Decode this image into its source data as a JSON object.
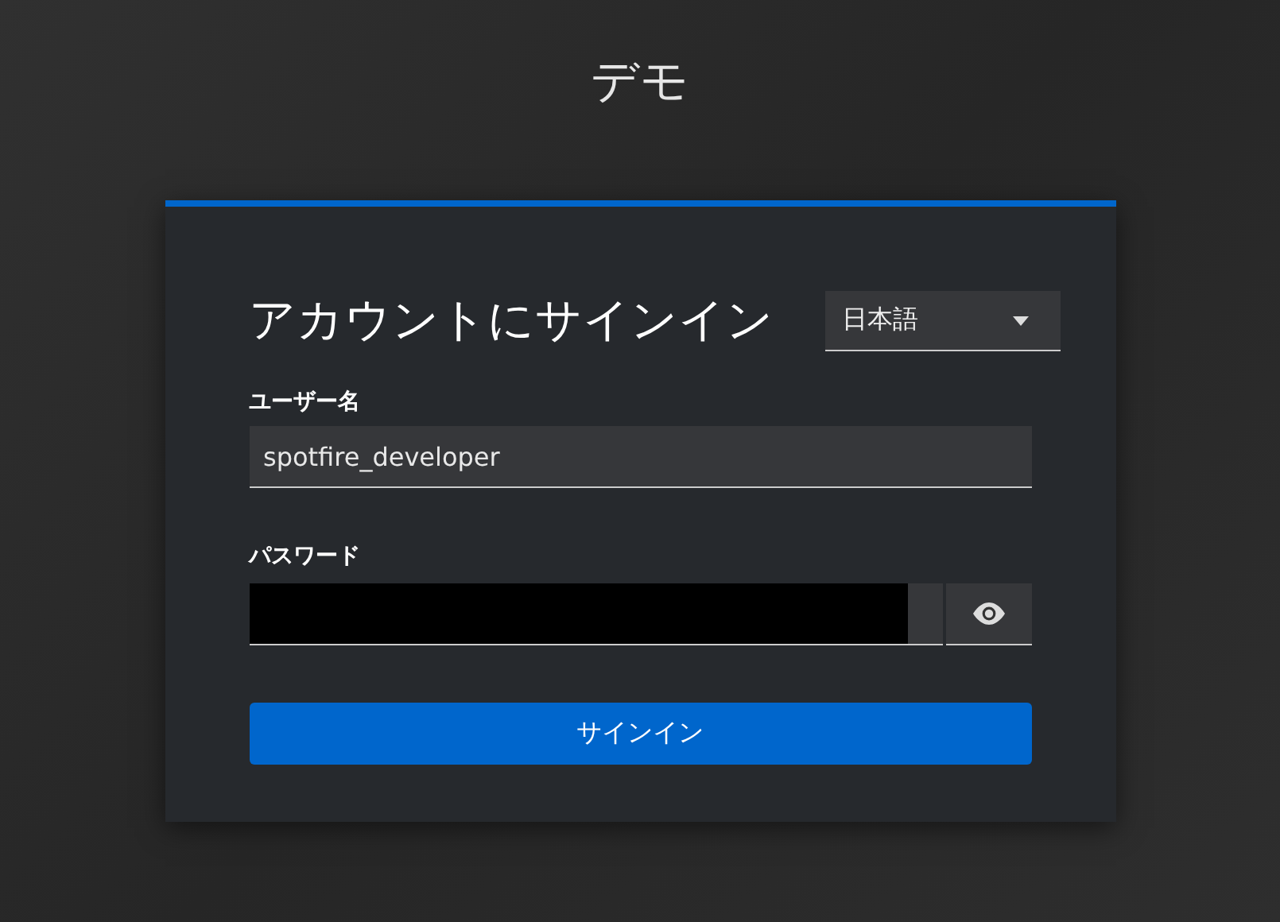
{
  "realm_title": "デモ",
  "card": {
    "heading": "アカウントにサインイン",
    "language_select": {
      "value": "日本語"
    },
    "username": {
      "label": "ユーザー名",
      "value": "spotfire_developer"
    },
    "password": {
      "label": "パスワード",
      "redacted": true
    },
    "sign_in_button": "サインイン"
  }
}
